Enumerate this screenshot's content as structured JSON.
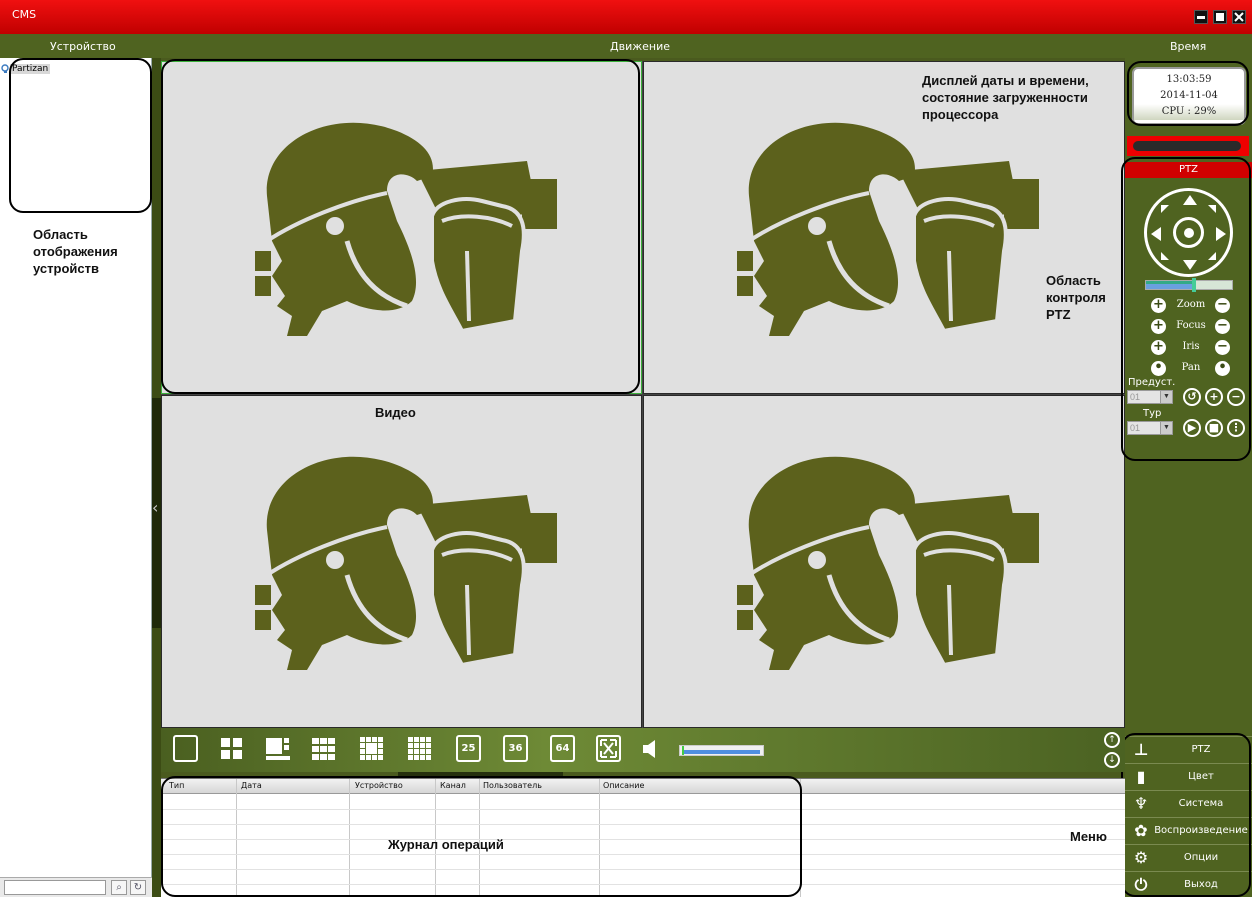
{
  "window": {
    "title": "CMS"
  },
  "header": {
    "device": "Устройство",
    "motion": "Движение",
    "time": "Время"
  },
  "device_tree": {
    "items": [
      {
        "label": "Partizan"
      }
    ]
  },
  "clock": {
    "time": "13:03:59",
    "date": "2014-11-04",
    "cpu": "CPU : 29%"
  },
  "ptz": {
    "title": "PTZ",
    "zoom": "Zoom",
    "focus": "Focus",
    "iris": "Iris",
    "pan": "Pan",
    "preset_label": "Предуст.",
    "preset_value": "01",
    "tour_label": "Тур",
    "tour_value": "01"
  },
  "toolbar": {
    "layout_25": "25",
    "layout_36": "36",
    "layout_64": "64",
    "volume_level": 0.95
  },
  "log": {
    "columns": [
      "Тип",
      "Дата",
      "Устройство",
      "Канал",
      "Пользователь",
      "Описание"
    ],
    "rows": []
  },
  "menu": {
    "items": [
      {
        "label": "PTZ",
        "icon": "ptz-icon"
      },
      {
        "label": "Цвет",
        "icon": "color-icon"
      },
      {
        "label": "Система",
        "icon": "system-icon"
      },
      {
        "label": "Воспроизведение",
        "icon": "playback-icon"
      },
      {
        "label": "Опции",
        "icon": "options-icon"
      },
      {
        "label": "Выход",
        "icon": "power-icon"
      }
    ]
  },
  "annotations": {
    "devices_area": "Область отображения устройств",
    "datetime": "Дисплей даты и времени, состояние загруженности процессора",
    "ptz_area": "Область контроля PTZ",
    "video": "Видео",
    "log": "Журнал операций",
    "menu": "Меню"
  },
  "colors": {
    "title_bar": "#e00000",
    "panel": "#4f6320",
    "placeholder": "#5c611c",
    "video_bg": "#e0e0e0"
  }
}
